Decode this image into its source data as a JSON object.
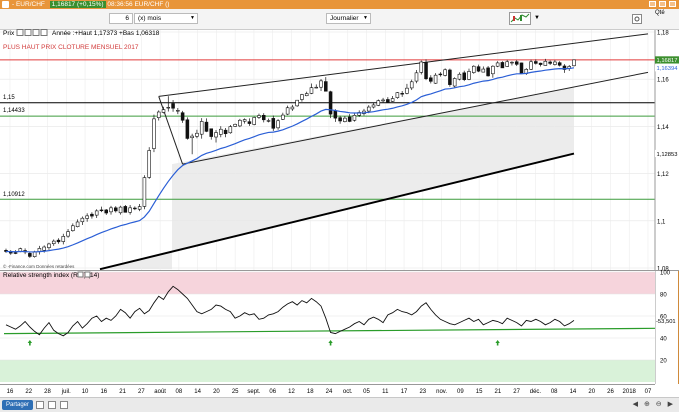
{
  "window": {
    "symbol": "- EUR/CHF",
    "price_badge": "1,16817 (+0,15%)",
    "time_text": "08:36:56 EUR/CHF ()"
  },
  "toolbar": {
    "period_value": "6",
    "period_unit": "(x) mois",
    "interval": "Journalier",
    "qte_label": "Qté"
  },
  "legend": {
    "prix_label": "Prix",
    "ohlc_text": "Année :+Haut 1,17373 +Bas 1,06318",
    "annotation": "PLUS HAUT PRIX CLOTURE MENSUEL 2017",
    "credit": "© ‐Finance.com  Données retardées",
    "rsi_title": "Relative strength index (RSI) (14)"
  },
  "colors": {
    "accent": "#e8953a",
    "up": "#ffffff",
    "down": "#111111",
    "ma": "#2b5fd6",
    "resistance": "#e23b3b",
    "support": "#3c9b3c",
    "last_price_bg": "#3c8f2e",
    "rsi_overbought": "#f6d4dc",
    "rsi_oversold": "#d9f2d9"
  },
  "bottom": {
    "share_label": "Partager"
  },
  "chart_data": {
    "type": "candlestick",
    "price": {
      "ylim": [
        1.08,
        1.18
      ],
      "yticks": [
        "1,18",
        "1,16",
        "1,14",
        "1,12",
        "1,1",
        "1,08"
      ],
      "x_labels": [
        "16",
        "22",
        "28",
        "juil.",
        "10",
        "16",
        "21",
        "27",
        "août",
        "08",
        "14",
        "20",
        "25",
        "sept.",
        "06",
        "12",
        "18",
        "24",
        "oct.",
        "05",
        "11",
        "17",
        "23",
        "nov.",
        "09",
        "15",
        "21",
        "27",
        "déc.",
        "08",
        "14",
        "20",
        "26",
        "2018",
        "07"
      ],
      "candles": [
        [
          1.0875,
          1.087,
          1.0882,
          1.0864
        ],
        [
          1.087,
          1.0863,
          1.0876,
          1.0856
        ],
        [
          1.0865,
          1.0862,
          1.0876,
          1.0859
        ],
        [
          1.0869,
          1.0882,
          1.0886,
          1.0867
        ],
        [
          1.0874,
          1.0868,
          1.0883,
          1.0859
        ],
        [
          1.0862,
          1.0849,
          1.0866,
          1.0843
        ],
        [
          1.0848,
          1.0869,
          1.0873,
          1.0844
        ],
        [
          1.0869,
          1.0883,
          1.0894,
          1.0857
        ],
        [
          1.0875,
          1.0889,
          1.0896,
          1.0865
        ],
        [
          1.0886,
          1.0902,
          1.0907,
          1.0877
        ],
        [
          1.0903,
          1.0914,
          1.0921,
          1.0894
        ],
        [
          1.0918,
          1.0911,
          1.0926,
          1.0903
        ],
        [
          1.0912,
          1.0934,
          1.0945,
          1.09
        ],
        [
          1.0935,
          1.0954,
          1.0965,
          1.0928
        ],
        [
          1.0958,
          1.0979,
          1.0989,
          1.0954
        ],
        [
          1.0975,
          1.0995,
          1.1006,
          1.0972
        ],
        [
          1.0996,
          1.1011,
          1.1018,
          1.0982
        ],
        [
          1.101,
          1.1021,
          1.1032,
          1.0996
        ],
        [
          1.1028,
          1.102,
          1.1036,
          1.1009
        ],
        [
          1.1024,
          1.1042,
          1.1049,
          1.1012
        ],
        [
          1.1046,
          1.1044,
          1.106,
          1.1037
        ],
        [
          1.1046,
          1.1033,
          1.105,
          1.1025
        ],
        [
          1.1038,
          1.1055,
          1.1063,
          1.1026
        ],
        [
          1.1055,
          1.1042,
          1.1062,
          1.1035
        ],
        [
          1.1034,
          1.1058,
          1.1064,
          1.1026
        ],
        [
          1.1061,
          1.1036,
          1.1067,
          1.1035
        ],
        [
          1.1036,
          1.1055,
          1.1067,
          1.1026
        ],
        [
          1.1054,
          1.1052,
          1.1061,
          1.1045
        ],
        [
          1.1049,
          1.106,
          1.1071,
          1.1041
        ],
        [
          1.1061,
          1.1183,
          1.1193,
          1.1049
        ],
        [
          1.1184,
          1.1298,
          1.1312,
          1.1178
        ],
        [
          1.1306,
          1.1432,
          1.145,
          1.1291
        ],
        [
          1.1437,
          1.1461,
          1.1468,
          1.1425
        ],
        [
          1.1459,
          1.1471,
          1.1483,
          1.1455
        ],
        [
          1.1478,
          1.1481,
          1.1528,
          1.1463
        ],
        [
          1.1497,
          1.1477,
          1.1512,
          1.1462
        ],
        [
          1.1465,
          1.1468,
          1.1478,
          1.1452
        ],
        [
          1.1458,
          1.1426,
          1.1466,
          1.1415
        ],
        [
          1.1428,
          1.1349,
          1.1438,
          1.1344
        ],
        [
          1.1352,
          1.1359,
          1.1369,
          1.1282
        ],
        [
          1.1358,
          1.1371,
          1.1386,
          1.135
        ],
        [
          1.1367,
          1.1421,
          1.1435,
          1.1348
        ],
        [
          1.1418,
          1.1379,
          1.1434,
          1.1376
        ],
        [
          1.139,
          1.1357,
          1.1391,
          1.1344
        ],
        [
          1.1355,
          1.1374,
          1.1385,
          1.1332
        ],
        [
          1.1366,
          1.1388,
          1.1401,
          1.1354
        ],
        [
          1.1384,
          1.1369,
          1.1393,
          1.1354
        ],
        [
          1.1373,
          1.1399,
          1.1406,
          1.1369
        ],
        [
          1.14,
          1.1409,
          1.1412,
          1.1398
        ],
        [
          1.1402,
          1.1426,
          1.1432,
          1.1397
        ],
        [
          1.1422,
          1.1429,
          1.1434,
          1.1412
        ],
        [
          1.142,
          1.1412,
          1.1434,
          1.1402
        ],
        [
          1.1408,
          1.1438,
          1.1441,
          1.1405
        ],
        [
          1.1438,
          1.1446,
          1.1454,
          1.1432
        ],
        [
          1.1447,
          1.1428,
          1.1456,
          1.1417
        ],
        [
          1.1424,
          1.1425,
          1.1433,
          1.1417
        ],
        [
          1.1434,
          1.1392,
          1.1446,
          1.1381
        ],
        [
          1.1394,
          1.1424,
          1.1431,
          1.1386
        ],
        [
          1.143,
          1.1448,
          1.1458,
          1.1427
        ],
        [
          1.1452,
          1.1479,
          1.1488,
          1.1448
        ],
        [
          1.1474,
          1.1482,
          1.1491,
          1.1466
        ],
        [
          1.1487,
          1.1511,
          1.1512,
          1.1483
        ],
        [
          1.1514,
          1.1535,
          1.1538,
          1.1505
        ],
        [
          1.153,
          1.1539,
          1.1547,
          1.1528
        ],
        [
          1.154,
          1.1564,
          1.1582,
          1.1537
        ],
        [
          1.1563,
          1.1566,
          1.1578,
          1.1561
        ],
        [
          1.1566,
          1.1593,
          1.1601,
          1.155
        ],
        [
          1.159,
          1.1549,
          1.1609,
          1.1548
        ],
        [
          1.1547,
          1.1452,
          1.1551,
          1.1435
        ],
        [
          1.1465,
          1.1435,
          1.1473,
          1.1419
        ],
        [
          1.1437,
          1.1423,
          1.1445,
          1.1411
        ],
        [
          1.142,
          1.1435,
          1.1444,
          1.1417
        ],
        [
          1.144,
          1.1421,
          1.1452,
          1.1418
        ],
        [
          1.1426,
          1.1447,
          1.1457,
          1.142
        ],
        [
          1.1447,
          1.1459,
          1.1468,
          1.144
        ],
        [
          1.1454,
          1.1465,
          1.1474,
          1.1446
        ],
        [
          1.1465,
          1.1482,
          1.149,
          1.1456
        ],
        [
          1.1482,
          1.1491,
          1.1499,
          1.1476
        ],
        [
          1.1489,
          1.1509,
          1.1514,
          1.1486
        ],
        [
          1.1508,
          1.1512,
          1.1521,
          1.1502
        ],
        [
          1.1514,
          1.1503,
          1.1524,
          1.1501
        ],
        [
          1.1506,
          1.1518,
          1.1529,
          1.1504
        ],
        [
          1.1522,
          1.1543,
          1.1546,
          1.1517
        ],
        [
          1.154,
          1.1539,
          1.155,
          1.1525
        ],
        [
          1.154,
          1.1562,
          1.158,
          1.1536
        ],
        [
          1.1563,
          1.1589,
          1.1598,
          1.1554
        ],
        [
          1.1592,
          1.1627,
          1.1639,
          1.1583
        ],
        [
          1.1629,
          1.1673,
          1.1679,
          1.162
        ],
        [
          1.1671,
          1.1602,
          1.1684,
          1.1596
        ],
        [
          1.1606,
          1.1591,
          1.1617,
          1.1582
        ],
        [
          1.1583,
          1.1617,
          1.1626,
          1.158
        ],
        [
          1.1622,
          1.162,
          1.163,
          1.1611
        ],
        [
          1.1616,
          1.164,
          1.1646,
          1.1612
        ],
        [
          1.1639,
          1.1577,
          1.1645,
          1.1568
        ],
        [
          1.1571,
          1.1603,
          1.1608,
          1.1563
        ],
        [
          1.16,
          1.1621,
          1.1629,
          1.1595
        ],
        [
          1.1627,
          1.1598,
          1.1636,
          1.1592
        ],
        [
          1.1599,
          1.1633,
          1.1645,
          1.1596
        ],
        [
          1.1628,
          1.1655,
          1.1659,
          1.1623
        ],
        [
          1.1653,
          1.1634,
          1.1662,
          1.163
        ],
        [
          1.163,
          1.1643,
          1.1654,
          1.163
        ],
        [
          1.1648,
          1.1614,
          1.1656,
          1.1611
        ],
        [
          1.1623,
          1.1655,
          1.1659,
          1.1606
        ],
        [
          1.1655,
          1.1669,
          1.1676,
          1.1651
        ],
        [
          1.1671,
          1.1648,
          1.1676,
          1.1648
        ],
        [
          1.1654,
          1.1674,
          1.1682,
          1.1652
        ],
        [
          1.1671,
          1.1672,
          1.1676,
          1.1658
        ],
        [
          1.1674,
          1.1663,
          1.1681,
          1.1656
        ],
        [
          1.1669,
          1.1625,
          1.1671,
          1.1622
        ],
        [
          1.1624,
          1.1642,
          1.1647,
          1.1618
        ],
        [
          1.1642,
          1.1674,
          1.1683,
          1.1639
        ],
        [
          1.1675,
          1.1667,
          1.1684,
          1.1662
        ],
        [
          1.1668,
          1.1662,
          1.167,
          1.1654
        ],
        [
          1.1658,
          1.1676,
          1.1686,
          1.1657
        ],
        [
          1.1673,
          1.1667,
          1.1679,
          1.166
        ],
        [
          1.1662,
          1.1673,
          1.1681,
          1.1658
        ],
        [
          1.167,
          1.1659,
          1.1676,
          1.1654
        ],
        [
          1.1656,
          1.1641,
          1.1664,
          1.1627
        ],
        [
          1.1646,
          1.1654,
          1.166,
          1.1635
        ],
        [
          1.1657,
          1.1682,
          1.1683,
          1.1654
        ]
      ],
      "ma_label": "1,16394",
      "last_price_label": "1,16817",
      "level_labels": {
        "l115": "1,15",
        "l114433": "1,14433",
        "l112853": "1,12853",
        "l110912": "1,10912"
      },
      "levels": {
        "resistance": 1.16817,
        "l115": 1.15,
        "l114433": 1.14433,
        "l112853": 1.12853,
        "l110912": 1.10912
      }
    },
    "rsi": {
      "ylim": [
        0,
        100
      ],
      "yticks": [
        "100",
        "80",
        "60",
        "40",
        "20"
      ],
      "last_value_label": "53,501",
      "overbought": 80,
      "oversold": 20,
      "values": [
        52,
        50,
        48,
        51,
        55,
        50,
        46,
        43,
        49,
        54,
        47,
        44,
        42,
        45,
        51,
        55,
        49,
        53,
        58,
        60,
        55,
        58,
        56,
        60,
        66,
        63,
        58,
        64,
        67,
        62,
        65,
        72,
        78,
        75,
        82,
        87,
        84,
        80,
        76,
        70,
        64,
        62,
        64,
        66,
        70,
        69,
        66,
        64,
        58,
        60,
        63,
        61,
        62,
        57,
        58,
        61,
        62,
        64,
        68,
        71,
        73,
        70,
        74,
        72,
        76,
        73,
        69,
        58,
        45,
        44,
        46,
        48,
        50,
        53,
        55,
        52,
        57,
        59,
        57,
        54,
        61,
        63,
        66,
        64,
        63,
        61,
        64,
        69,
        72,
        66,
        61,
        57,
        55,
        53,
        52,
        54,
        56,
        58,
        55,
        57,
        52,
        54,
        56,
        55,
        53,
        58,
        56,
        54,
        51,
        56,
        55,
        57,
        55,
        52,
        54,
        57,
        55,
        51,
        53,
        56
      ]
    }
  }
}
